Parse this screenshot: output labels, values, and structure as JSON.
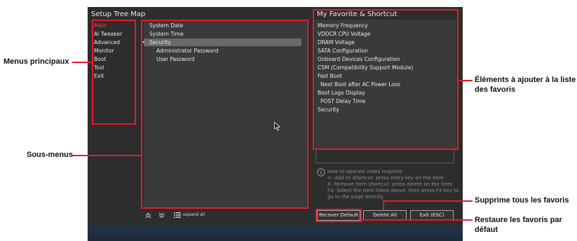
{
  "window": {
    "left_title": "Setup Tree Map",
    "right_title": "My Favorite & Shortcut"
  },
  "main_menu": {
    "items": [
      {
        "label": "Main",
        "active": true
      },
      {
        "label": "Ai Tweaker"
      },
      {
        "label": "Advanced"
      },
      {
        "label": "Monitor"
      },
      {
        "label": "Boot"
      },
      {
        "label": "Tool"
      },
      {
        "label": "Exit"
      }
    ]
  },
  "submenu": {
    "items": [
      {
        "label": "System Date"
      },
      {
        "label": "System Time"
      },
      {
        "label": "Security",
        "expanded": true,
        "selected": true,
        "marker": "▾"
      },
      {
        "label": "Administrator Password",
        "child": true
      },
      {
        "label": "User Password",
        "child": true
      }
    ]
  },
  "favorites": {
    "items": [
      {
        "label": "Memory Frequency"
      },
      {
        "label": "VDDCR CPU Voltage"
      },
      {
        "label": "DRAM Voltage"
      },
      {
        "label": "SATA Configuration"
      },
      {
        "label": "Onboard Devices Configuration"
      },
      {
        "label": "CSM (Compatibility Support Module)"
      },
      {
        "label": "Fast Boot"
      },
      {
        "label": "Next Boot after AC Power Loss",
        "child": true
      },
      {
        "label": "Boot Logo Display"
      },
      {
        "label": "POST Delay Time",
        "child": true
      },
      {
        "label": "Security"
      }
    ]
  },
  "info": {
    "icon": "info-circle-icon",
    "lines": [
      "How to operate index maptree",
      "+: Add to shortcut: press entry key on the item",
      "X: Remove form shortcut: press delete on the item",
      "F4: Select the item listed above, then press F4 key to",
      "go to the page directly."
    ]
  },
  "toolbar": {
    "collapse_icon": "double-chevron-up-icon",
    "expand_icon": "double-chevron-down-icon",
    "expand_all_icon": "list-icon",
    "expand_all_label": "expand all"
  },
  "buttons": {
    "recover_default": "Recover Default",
    "delete_all": "Delete All",
    "exit": "Exit (ESC)"
  },
  "annotations": {
    "main_menus": "Menus principaux",
    "submenus": "Sous-menus",
    "favorites_line1": "Éléments à ajouter à la liste",
    "favorites_line2": "des favoris",
    "delete_all": "Supprime tous les favoris",
    "restore_line1": "Restaure les favoris par",
    "restore_line2": "défaut"
  },
  "colors": {
    "accent_red": "#e31b2b",
    "active_item": "#f0426a",
    "background": "#2d2d2d"
  }
}
